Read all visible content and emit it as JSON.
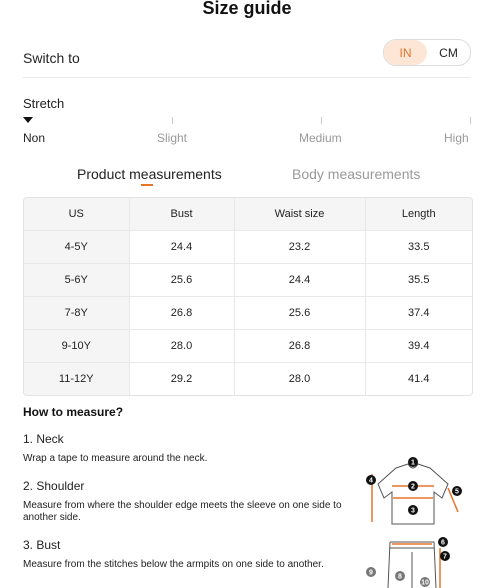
{
  "header": {
    "title": "Size guide"
  },
  "units": {
    "switch_label": "Switch to",
    "options": [
      "IN",
      "CM"
    ],
    "active": "IN"
  },
  "stretch": {
    "label": "Stretch",
    "options": [
      "Non",
      "Slight",
      "Medium",
      "High"
    ],
    "selected": "Non"
  },
  "tabs": {
    "product": "Product measurements",
    "body": "Body measurements",
    "active": "product"
  },
  "table": {
    "headers": [
      "US",
      "Bust",
      "Waist size",
      "Length"
    ],
    "rows": [
      [
        "4-5Y",
        "24.4",
        "23.2",
        "33.5"
      ],
      [
        "5-6Y",
        "25.6",
        "24.4",
        "35.5"
      ],
      [
        "7-8Y",
        "26.8",
        "25.6",
        "37.4"
      ],
      [
        "9-10Y",
        "28.0",
        "26.8",
        "39.4"
      ],
      [
        "11-12Y",
        "29.2",
        "28.0",
        "41.4"
      ]
    ]
  },
  "howto": {
    "title": "How to measure?",
    "steps": [
      {
        "title": "1. Neck",
        "desc": "Wrap a tape to measure around the neck."
      },
      {
        "title": "2. Shoulder",
        "desc": "Measure from where the shoulder edge meets the sleeve on one side to another side."
      },
      {
        "title": "3. Bust",
        "desc": "Measure from the stitches below the armpits on one side to another."
      }
    ]
  },
  "diagram": {
    "markers": [
      "1",
      "2",
      "3",
      "4",
      "5",
      "6",
      "7",
      "8",
      "9",
      "10"
    ],
    "accent": "#e8742a"
  },
  "colors": {
    "accent": "#e8742a",
    "accent_bg": "#fde6d6"
  }
}
